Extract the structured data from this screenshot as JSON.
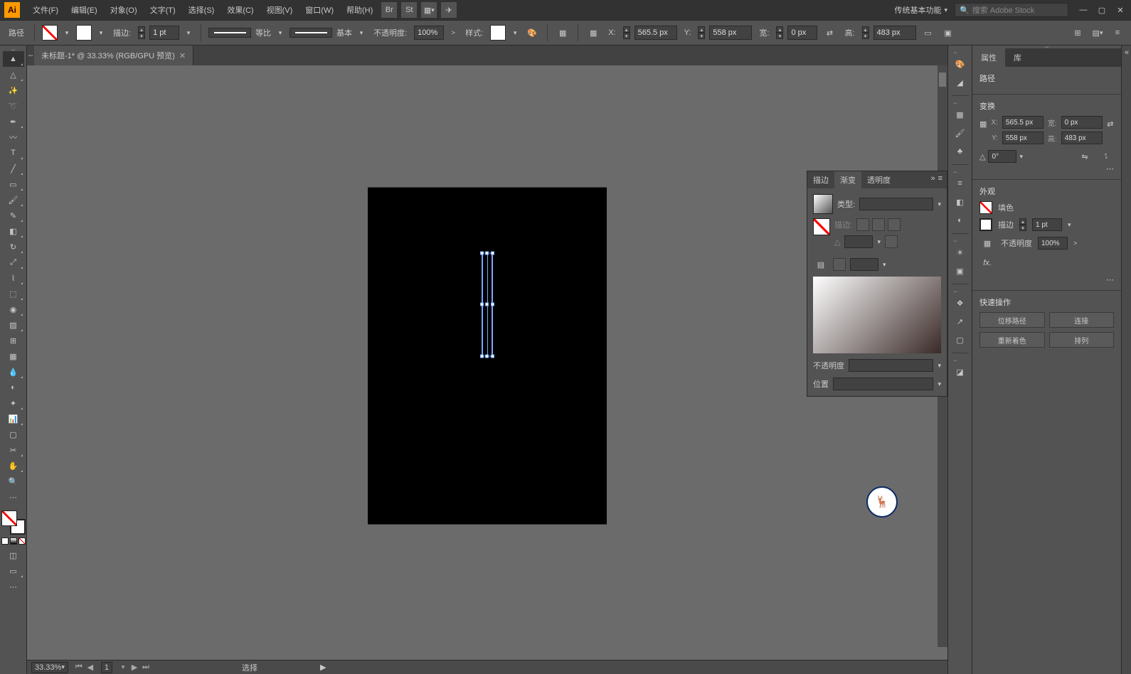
{
  "menubar": {
    "items": [
      "文件(F)",
      "编辑(E)",
      "对象(O)",
      "文字(T)",
      "选择(S)",
      "效果(C)",
      "视图(V)",
      "窗口(W)",
      "帮助(H)"
    ],
    "workspace": "传统基本功能",
    "search_placeholder": "搜索 Adobe Stock"
  },
  "ctrlbar": {
    "object_type": "路径",
    "stroke_label": "描边:",
    "stroke_pt": "1 pt",
    "profile_label": "等比",
    "brush_label": "基本",
    "opacity_label": "不透明度:",
    "opacity_val": "100%",
    "style_label": "样式:",
    "x_label": "X:",
    "x_val": "565.5 px",
    "y_label": "Y:",
    "y_val": "558 px",
    "w_label": "宽:",
    "w_val": "0 px",
    "h_label": "高:",
    "h_val": "483 px"
  },
  "doc": {
    "tab_title": "未标题-1* @ 33.33% (RGB/GPU 预览)",
    "zoom": "33.33%",
    "page": "1",
    "tool_hint": "选择"
  },
  "gradient_panel": {
    "tabs": [
      "描边",
      "渐变",
      "透明度"
    ],
    "type_label": "类型:",
    "stroke_label": "描边:",
    "opacity_label": "不透明度",
    "location_label": "位置"
  },
  "props": {
    "tabs": [
      "属性",
      "库"
    ],
    "section_path": "路径",
    "section_transform": "变换",
    "X": "565.5 px",
    "W": "0 px",
    "Y": "558 px",
    "H": "483 px",
    "angle": "0°",
    "x_lbl": "X:",
    "y_lbl": "Y:",
    "w_lbl": "宽:",
    "h_lbl": "高:",
    "section_appearance": "外观",
    "fill_label": "填色",
    "stroke_label": "描边",
    "stroke_val": "1 pt",
    "opacity_label": "不透明度",
    "opacity_val": "100%",
    "fx_label": "fx.",
    "section_quick": "快速操作",
    "btns": [
      "位移路径",
      "连接",
      "重新着色",
      "排列"
    ]
  }
}
